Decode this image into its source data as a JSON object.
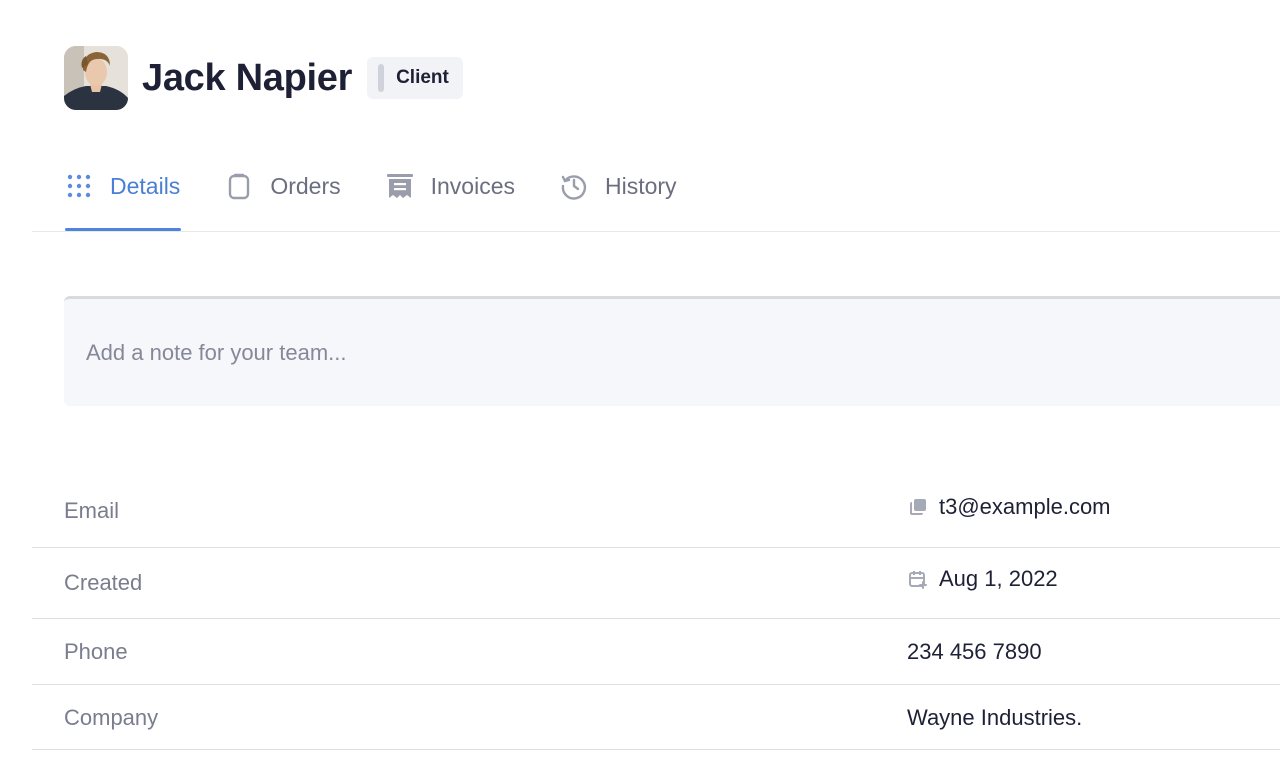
{
  "header": {
    "name": "Jack Napier",
    "badge": "Client"
  },
  "tabs": [
    {
      "label": "Details",
      "icon": "grid-dots-icon",
      "active": true
    },
    {
      "label": "Orders",
      "icon": "clipboard-icon",
      "active": false
    },
    {
      "label": "Invoices",
      "icon": "receipt-icon",
      "active": false
    },
    {
      "label": "History",
      "icon": "history-icon",
      "active": false
    }
  ],
  "note": {
    "placeholder": "Add a note for your team...",
    "value": ""
  },
  "details": {
    "email": {
      "label": "Email",
      "value": "t3@example.com",
      "icon": "copy-icon"
    },
    "created": {
      "label": "Created",
      "value": "Aug 1, 2022",
      "icon": "calendar-plus-icon"
    },
    "phone": {
      "label": "Phone",
      "value": "234 456 7890"
    },
    "company": {
      "label": "Company",
      "value": "Wayne Industries."
    }
  },
  "colors": {
    "accent": "#4a7fd6",
    "text": "#1e2136",
    "muted": "#7a7d8e",
    "divider": "#dfe0e6"
  }
}
